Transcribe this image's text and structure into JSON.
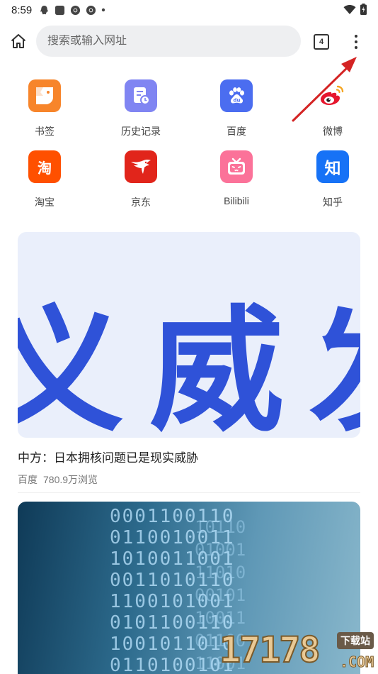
{
  "status_bar": {
    "time": "8:59"
  },
  "toolbar": {
    "search_placeholder": "搜索或输入网址",
    "tab_count": "4"
  },
  "shortcuts": [
    {
      "label": "书签",
      "color": "#f7852b",
      "icon": "bookmark-icon"
    },
    {
      "label": "历史记录",
      "color": "#8085f2",
      "icon": "history-icon"
    },
    {
      "label": "百度",
      "color": "#4b6df0",
      "icon": "baidu-icon"
    },
    {
      "label": "微博",
      "color": "#e6162d",
      "icon": "weibo-icon"
    },
    {
      "label": "淘宝",
      "color": "#ff5000",
      "icon": "taobao-icon",
      "glyph": "淘"
    },
    {
      "label": "京东",
      "color": "#e1251b",
      "icon": "jd-icon"
    },
    {
      "label": "Bilibili",
      "color": "#fb7299",
      "icon": "bilibili-icon"
    },
    {
      "label": "知乎",
      "color": "#1772f6",
      "icon": "zhihu-icon",
      "glyph": "知"
    }
  ],
  "feed": [
    {
      "image_text": "义威发言",
      "title": "中方：日本拥核问题已是现实威胁",
      "source": "百度",
      "views": "780.9万浏览"
    },
    {
      "image_alt": "digital-data-image"
    }
  ],
  "watermark": {
    "number": "17178",
    "tag": "下载站",
    "domain": ".COM"
  }
}
